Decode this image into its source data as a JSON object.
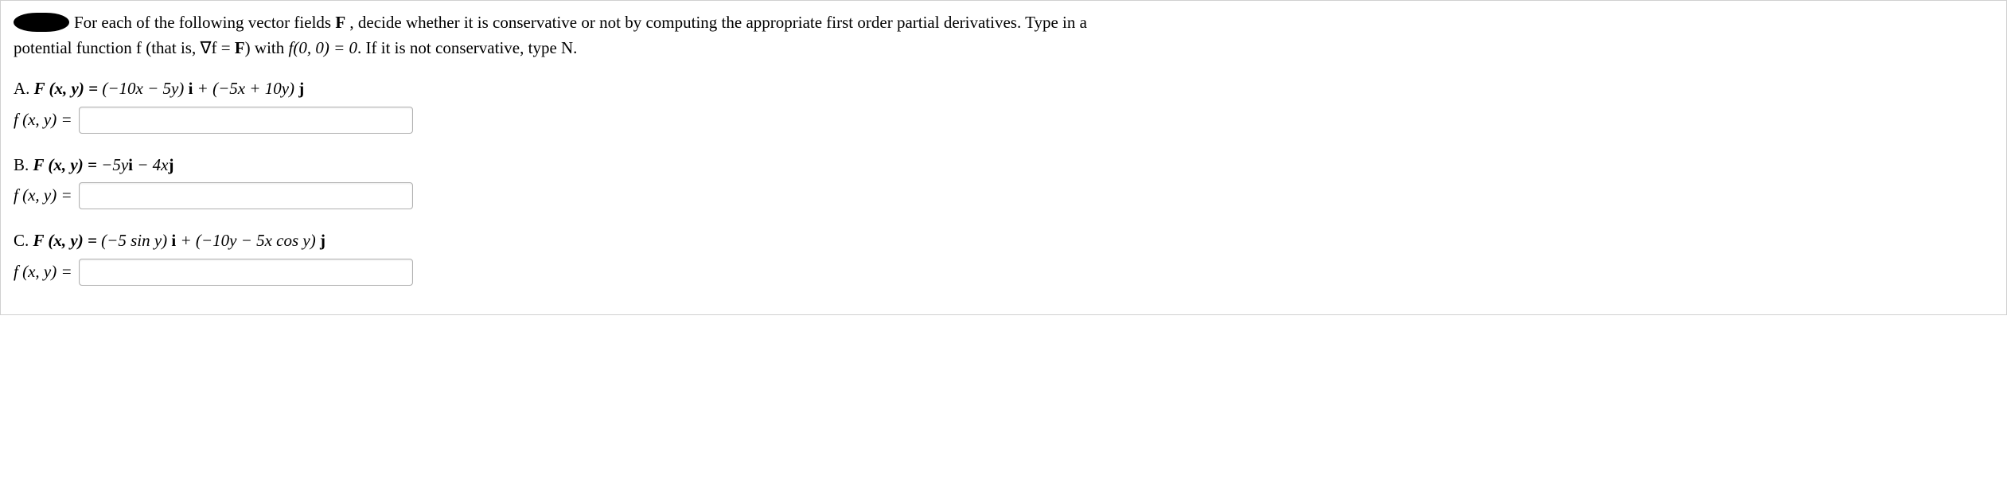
{
  "intro": {
    "line1_part1": "For each of the following vector fields ",
    "line1_F": "F",
    "line1_part2": " , decide whether it is conservative or not by computing the appropriate first order partial derivatives. Type in a",
    "line2_part1": "potential function f (that is, ",
    "line2_grad": "∇f = ",
    "line2_F": "F",
    "line2_part2": ") with ",
    "line2_cond": "f(0, 0) = 0",
    "line2_part3": ". If it is not conservative, type N."
  },
  "problems": {
    "A": {
      "label": "A. ",
      "lhs": "F (x, y) = ",
      "rhs_part1": "(−10x − 5y) ",
      "i": "i",
      "rhs_part2": " + (−5x + 10y) ",
      "j": "j",
      "answer_label": "f (x, y) =",
      "value": ""
    },
    "B": {
      "label": "B. ",
      "lhs": "F (x, y) = ",
      "rhs_part1": "−5y",
      "i": "i",
      "rhs_part2": " − 4x",
      "j": "j",
      "answer_label": "f (x, y) =",
      "value": ""
    },
    "C": {
      "label": "C. ",
      "lhs": "F (x, y) = ",
      "rhs_part1": "(−5 sin y) ",
      "i": "i",
      "rhs_part2": " + (−10y − 5x cos y) ",
      "j": "j",
      "answer_label": "f (x, y) =",
      "value": ""
    }
  }
}
